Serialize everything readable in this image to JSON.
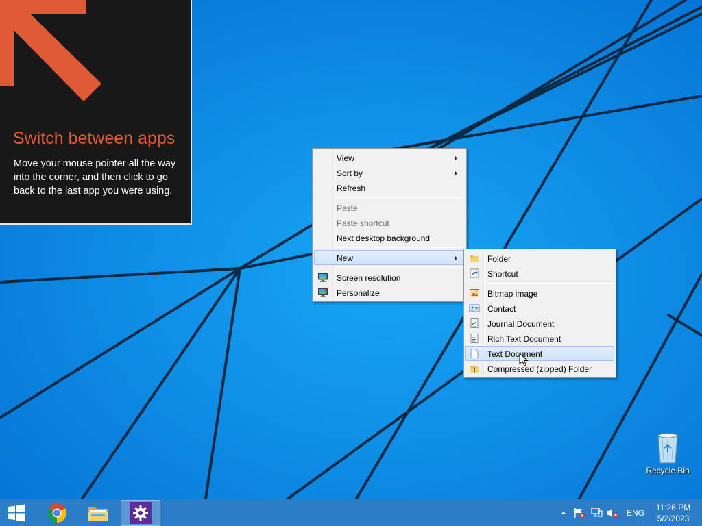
{
  "tip": {
    "title": "Switch between apps",
    "body": "Move your mouse pointer all the way into the corner, and then click to go back to the last app you were using."
  },
  "context_menu": {
    "items": [
      {
        "label": "View",
        "submenu": true
      },
      {
        "label": "Sort by",
        "submenu": true
      },
      {
        "label": "Refresh"
      },
      {
        "label": "Paste",
        "disabled": true
      },
      {
        "label": "Paste shortcut",
        "disabled": true
      },
      {
        "label": "Next desktop background"
      },
      {
        "label": "New",
        "submenu": true,
        "highlighted": true
      },
      {
        "label": "Screen resolution",
        "icon": "display-icon"
      },
      {
        "label": "Personalize",
        "icon": "personalize-icon"
      }
    ]
  },
  "new_submenu": {
    "items": [
      {
        "label": "Folder",
        "icon": "folder-icon"
      },
      {
        "label": "Shortcut",
        "icon": "shortcut-icon"
      },
      {
        "label": "Bitmap image",
        "icon": "bitmap-icon"
      },
      {
        "label": "Contact",
        "icon": "contact-icon"
      },
      {
        "label": "Journal Document",
        "icon": "journal-icon"
      },
      {
        "label": "Rich Text Document",
        "icon": "rich-text-icon"
      },
      {
        "label": "Text Document",
        "icon": "text-document-icon",
        "highlighted": true
      },
      {
        "label": "Compressed (zipped) Folder",
        "icon": "zip-folder-icon"
      }
    ]
  },
  "desktop_icons": {
    "recycle_bin": "Recycle Bin"
  },
  "taskbar": {
    "apps": [
      "start-icon",
      "chrome-icon",
      "file-explorer-icon",
      "settings-icon"
    ],
    "active_app": "settings-icon",
    "language": "ENG",
    "time": "11:26 PM",
    "date": "5/2/2023"
  },
  "colors": {
    "desktop": "#0b8de6",
    "tip_title": "#e05a36",
    "taskbar": "#2c7dc8",
    "highlight": "#cfe2f8"
  }
}
